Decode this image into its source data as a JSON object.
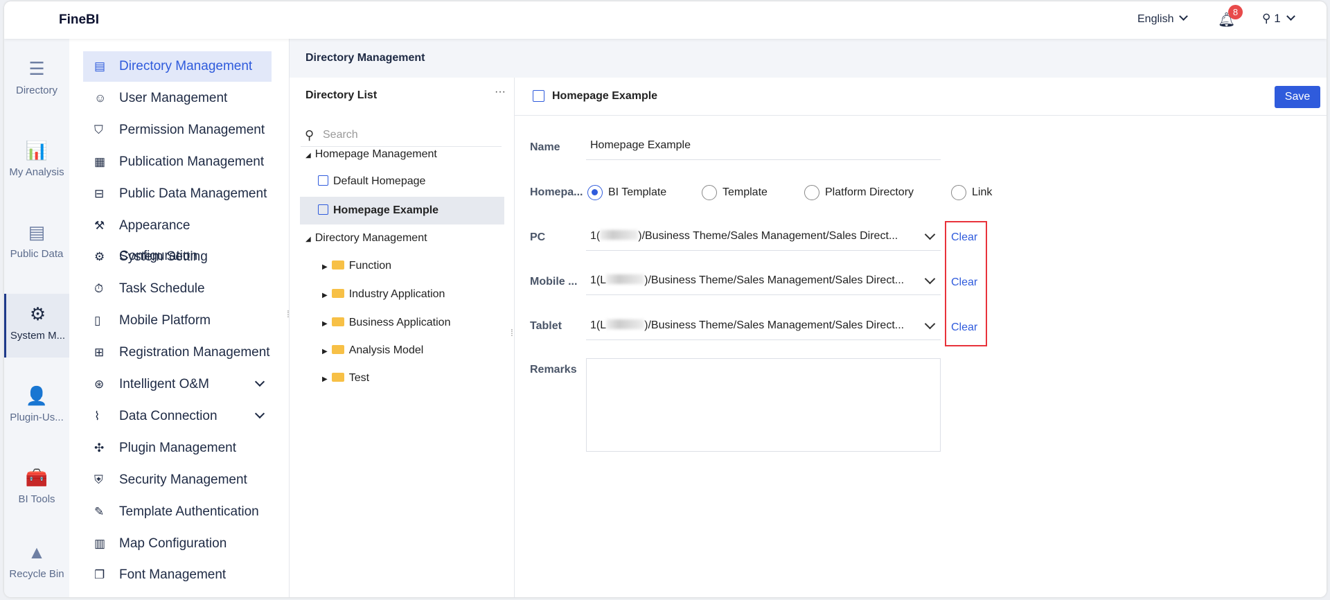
{
  "header": {
    "logo": "FineBI",
    "language": "English",
    "notifications": "8",
    "user": "1"
  },
  "rail": [
    {
      "label": "Directory",
      "icon": "directory-icon",
      "glyph": "☰"
    },
    {
      "label": "My Analysis",
      "icon": "analysis-icon",
      "glyph": "📊"
    },
    {
      "label": "Public Data",
      "icon": "public-data-icon",
      "glyph": "▤"
    },
    {
      "label": "System M...",
      "icon": "system-management-icon",
      "glyph": "⚙",
      "active": true
    },
    {
      "label": "Plugin-Us...",
      "icon": "plugin-user-icon",
      "glyph": "👤"
    },
    {
      "label": "BI Tools",
      "icon": "bi-tools-icon",
      "glyph": "🧰"
    },
    {
      "label": "Recycle Bin",
      "icon": "recycle-bin-icon",
      "glyph": "▲"
    }
  ],
  "menu": [
    {
      "label": "Directory Management",
      "icon": "directory-list-icon",
      "glyph": "▤",
      "active": true
    },
    {
      "label": "User Management",
      "icon": "user-icon",
      "glyph": "☺"
    },
    {
      "label": "Permission Management",
      "icon": "permission-icon",
      "glyph": "⛉"
    },
    {
      "label": "Publication Management",
      "icon": "publication-icon",
      "glyph": "▦"
    },
    {
      "label": "Public Data Management",
      "icon": "public-data-icon",
      "glyph": "⊟"
    },
    {
      "label": "Appearance Configuration",
      "icon": "paint-roller-icon",
      "glyph": "⚒"
    },
    {
      "label": "System Setting",
      "icon": "gear-icon",
      "glyph": "⚙"
    },
    {
      "label": "Task Schedule",
      "icon": "timer-icon",
      "glyph": "⏱"
    },
    {
      "label": "Mobile Platform",
      "icon": "mobile-icon",
      "glyph": "▯"
    },
    {
      "label": "Registration Management",
      "icon": "registration-icon",
      "glyph": "⊞"
    },
    {
      "label": "Intelligent O&M",
      "icon": "om-icon",
      "glyph": "⊛",
      "expand": true
    },
    {
      "label": "Data Connection",
      "icon": "paperclip-icon",
      "glyph": "⌇",
      "expand": true
    },
    {
      "label": "Plugin Management",
      "icon": "puzzle-icon",
      "glyph": "✣"
    },
    {
      "label": "Security Management",
      "icon": "shield-icon",
      "glyph": "⛨"
    },
    {
      "label": "Template Authentication",
      "icon": "template-auth-icon",
      "glyph": "✎"
    },
    {
      "label": "Map Configuration",
      "icon": "map-icon",
      "glyph": "▥"
    },
    {
      "label": "Font Management",
      "icon": "font-icon",
      "glyph": "❐"
    }
  ],
  "breadcrumb": "Directory Management",
  "directory_list": {
    "title": "Directory List",
    "more": "···",
    "search_placeholder": "Search",
    "tree": [
      {
        "label": "Homepage Management",
        "type": "group"
      },
      {
        "label": "Default Homepage",
        "type": "home"
      },
      {
        "label": "Homepage Example",
        "type": "home",
        "selected": true
      },
      {
        "label": "Directory Management",
        "type": "group"
      },
      {
        "label": "Function",
        "type": "folder"
      },
      {
        "label": "Industry Application",
        "type": "folder"
      },
      {
        "label": "Business Application",
        "type": "folder"
      },
      {
        "label": "Analysis Model",
        "type": "folder"
      },
      {
        "label": "Test",
        "type": "folder"
      }
    ]
  },
  "panel": {
    "title": "Homepage Example",
    "save": "Save",
    "name_label": "Name",
    "name_value": "Homepage Example",
    "type_label": "Homepa...",
    "types": [
      "BI Template",
      "Template",
      "Platform Directory",
      "Link"
    ],
    "selected_type": "BI Template",
    "pc_label": "PC",
    "mobile_label": "Mobile ...",
    "tablet_label": "Tablet",
    "path_prefix_pc": "1(",
    "path_prefix": "1(L",
    "path_suffix": ")/Business Theme/Sales Management/Sales Direct...",
    "clear": "Clear",
    "remarks_label": "Remarks",
    "remarks_value": ""
  }
}
